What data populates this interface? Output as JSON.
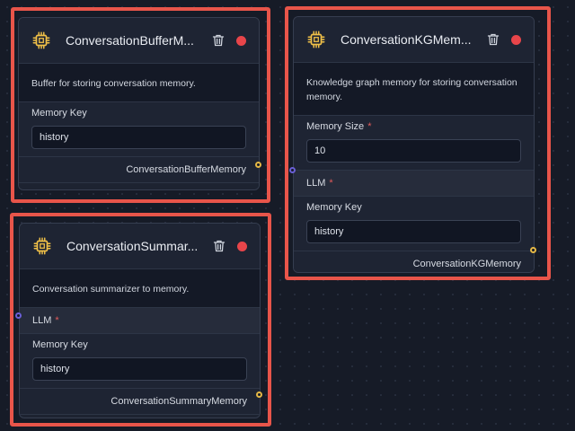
{
  "colors": {
    "frame": "#e8554a",
    "status_red": "#e8454a",
    "chip_yellow": "#f0c048",
    "input_handle": "#6a5fd6",
    "output_handle": "#e5b845",
    "required": "#e25b5b"
  },
  "nodes": {
    "buffer": {
      "title": "ConversationBufferM...",
      "description": "Buffer for storing conversation memory.",
      "memory_key_label": "Memory Key",
      "memory_key_value": "history",
      "output_label": "ConversationBufferMemory"
    },
    "summary": {
      "title": "ConversationSummar...",
      "description": "Conversation summarizer to memory.",
      "llm_label": "LLM",
      "llm_required": "*",
      "memory_key_label": "Memory Key",
      "memory_key_value": "history",
      "output_label": "ConversationSummaryMemory"
    },
    "kg": {
      "title": "ConversationKGMem...",
      "description": "Knowledge graph memory for storing conversation memory.",
      "memory_size_label": "Memory Size",
      "memory_size_required": "*",
      "memory_size_value": "10",
      "llm_label": "LLM",
      "llm_required": "*",
      "memory_key_label": "Memory Key",
      "memory_key_value": "history",
      "output_label": "ConversationKGMemory"
    }
  },
  "icons": {
    "chip": "chip-icon",
    "trash": "trash-icon"
  }
}
